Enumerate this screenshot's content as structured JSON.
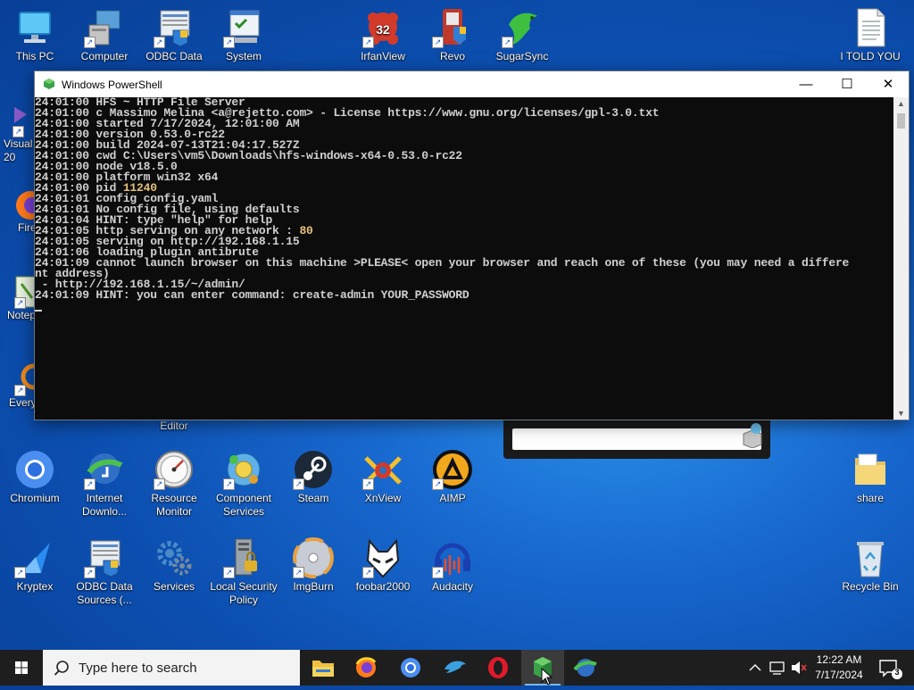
{
  "desktop": {
    "icons_top": [
      {
        "name": "desktop-icon-this-pc",
        "label": "This PC",
        "icon": "monitor-icon"
      },
      {
        "name": "desktop-icon-computer-management",
        "label": "Computer Management",
        "icon": "computer-management-icon"
      },
      {
        "name": "desktop-icon-odbc-data-sources",
        "label": "ODBC Data Sources",
        "icon": "odbc-icon"
      },
      {
        "name": "desktop-icon-system-configuration",
        "label": "System Configuration",
        "icon": "system-config-icon"
      },
      {
        "name": "desktop-icon-irfanview",
        "label": "IrfanView",
        "icon": "irfanview-icon",
        "badge": "32"
      },
      {
        "name": "desktop-icon-revo-uninstaller",
        "label": "Revo Uninstaller",
        "icon": "revo-icon"
      },
      {
        "name": "desktop-icon-sugarsync",
        "label": "SugarSync",
        "icon": "sugarsync-icon"
      },
      {
        "name": "desktop-icon-i-told-you",
        "label": "I TOLD YOU",
        "icon": "text-file-icon"
      }
    ],
    "icons_left_partial": [
      {
        "name": "desktop-icon-visual-studio",
        "label": "Visual 20",
        "icon": "visual-studio-icon"
      },
      {
        "name": "desktop-icon-firefox",
        "label": "Fire",
        "icon": "firefox-icon"
      },
      {
        "name": "desktop-icon-notepad",
        "label": "Notep",
        "icon": "notepad-icon"
      },
      {
        "name": "desktop-icon-everything",
        "label": "Every",
        "icon": "everything-icon"
      }
    ],
    "editor_label": "Editor",
    "icons_row1": [
      {
        "name": "desktop-icon-chromium",
        "label": "Chromium",
        "icon": "chromium-icon"
      },
      {
        "name": "desktop-icon-internet-download-manager",
        "label": "Internet Downlo...",
        "icon": "idm-icon"
      },
      {
        "name": "desktop-icon-resource-monitor",
        "label": "Resource Monitor",
        "icon": "gauge-icon"
      },
      {
        "name": "desktop-icon-component-services",
        "label": "Component Services",
        "icon": "component-services-icon"
      },
      {
        "name": "desktop-icon-steam",
        "label": "Steam",
        "icon": "steam-icon"
      },
      {
        "name": "desktop-icon-xnview",
        "label": "XnView",
        "icon": "xnview-icon"
      },
      {
        "name": "desktop-icon-aimp",
        "label": "AIMP",
        "icon": "aimp-icon"
      },
      {
        "name": "desktop-icon-share",
        "label": "share",
        "icon": "folder-icon"
      }
    ],
    "icons_row2": [
      {
        "name": "desktop-icon-kryptex",
        "label": "Kryptex",
        "icon": "kryptex-icon"
      },
      {
        "name": "desktop-icon-odbc-data-sources-2",
        "label": "ODBC Data Sources (...",
        "icon": "odbc-icon"
      },
      {
        "name": "desktop-icon-services",
        "label": "Services",
        "icon": "gears-icon"
      },
      {
        "name": "desktop-icon-local-security-policy",
        "label": "Local Security Policy",
        "icon": "security-policy-icon"
      },
      {
        "name": "desktop-icon-imgburn",
        "label": "ImgBurn",
        "icon": "disc-icon"
      },
      {
        "name": "desktop-icon-foobar2000",
        "label": "foobar2000",
        "icon": "foobar-icon"
      },
      {
        "name": "desktop-icon-audacity",
        "label": "Audacity",
        "icon": "audacity-icon"
      },
      {
        "name": "desktop-icon-recycle-bin",
        "label": "Recycle Bin",
        "icon": "recycle-bin-icon"
      }
    ]
  },
  "window": {
    "title": "Windows PowerShell",
    "minimize": "—",
    "maximize": "☐",
    "close": "✕"
  },
  "console": {
    "lines": [
      [
        "24:01:00 HFS ~ HTTP File Server"
      ],
      [
        "24:01:00 c Massimo Melina <a@rejetto.com> - License https://www.gnu.org/licenses/gpl-3.0.txt"
      ],
      [
        "24:01:00 started 7/17/2024, 12:01:00 AM"
      ],
      [
        "24:01:00 version 0.53.0-rc22"
      ],
      [
        "24:01:00 build 2024-07-13T21:04:17.527Z"
      ],
      [
        "24:01:00 cwd C:\\Users\\vm5\\Downloads\\hfs-windows-x64-0.53.0-rc22"
      ],
      [
        "24:01:00 node v18.5.0"
      ],
      [
        "24:01:00 platform win32 x64"
      ],
      [
        "24:01:00 pid ",
        "11240"
      ],
      [
        "24:01:01 config config.yaml"
      ],
      [
        "24:01:01 No config file, using defaults"
      ],
      [
        "24:01:04 HINT: type \"help\" for help"
      ],
      [
        "24:01:05 http serving on any network : ",
        "80"
      ],
      [
        "24:01:05 serving on http://192.168.1.15"
      ],
      [
        "24:01:06 loading plugin antibrute"
      ],
      [
        "24:01:09 cannot launch browser on this machine >PLEASE< open your browser and reach one of these (you may need a differe"
      ],
      [
        "nt address)"
      ],
      [
        " - http://192.168.1.15/~/admin/"
      ],
      [
        "24:01:09 HINT: you can enter command: create-admin YOUR_PASSWORD"
      ]
    ]
  },
  "taskbar": {
    "search_placeholder": "Type here to search",
    "apps": [
      "file-explorer-icon",
      "firefox-icon",
      "chromium-icon",
      "dolphin-icon",
      "opera-icon",
      "powershell-icon",
      "idm-icon"
    ],
    "time": "12:22 AM",
    "date": "7/17/2024",
    "notification_count": "3"
  }
}
